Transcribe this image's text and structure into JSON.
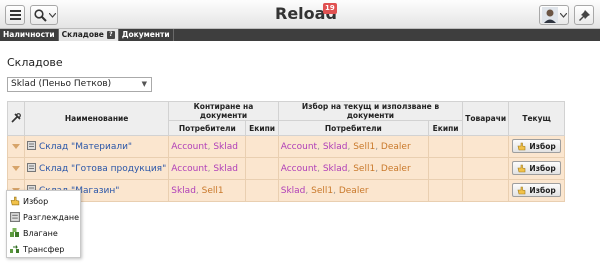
{
  "app": {
    "title": "Reload",
    "notification_count": "19"
  },
  "tabs": [
    {
      "label": "Наличности",
      "active": false
    },
    {
      "label": "Складове",
      "active": true
    },
    {
      "label": "Документи",
      "active": false
    }
  ],
  "page": {
    "heading": "Складове",
    "store_select": {
      "value": "Sklad (Пеньо Петков)"
    }
  },
  "table": {
    "headers": {
      "name": "Наименование",
      "contracts": "Контиране на документи",
      "choice": "Избор на текущ и използване в документи",
      "goods": "Товарачи",
      "current": "Текущ",
      "users": "Потребители",
      "teams": "Екипи",
      "users2": "Потребители",
      "teams2": "Екипи"
    },
    "rows": [
      {
        "name": "Склад \"Материали\"",
        "contract_users": [
          "Account",
          "Sklad"
        ],
        "choice_users": [
          "Account",
          "Sklad",
          "Sell1",
          "Dealer"
        ],
        "button": "Избор"
      },
      {
        "name": "Склад \"Готова продукция\"",
        "contract_users": [
          "Account",
          "Sklad"
        ],
        "choice_users": [
          "Account",
          "Sklad",
          "Sell1",
          "Dealer"
        ],
        "button": "Избор"
      },
      {
        "name": "Склад \"Магазин\"",
        "contract_users": [
          "Sklad",
          "Sell1"
        ],
        "choice_users": [
          "Sklad",
          "Sell1",
          "Dealer"
        ],
        "button": "Избор"
      }
    ]
  },
  "context_menu": {
    "items": [
      {
        "label": "Избор",
        "icon": "hand-pointer-icon"
      },
      {
        "label": "Разглеждане",
        "icon": "document-icon"
      },
      {
        "label": "Влагане",
        "icon": "boxes-icon"
      },
      {
        "label": "Трансфер",
        "icon": "transfer-icon"
      }
    ]
  },
  "colors": {
    "row_bg": "#fbe6cf",
    "link_purple": "#b03fb8",
    "link_orange": "#c9792b",
    "tab_bar": "#3e3e3e",
    "badge": "#e05151"
  }
}
